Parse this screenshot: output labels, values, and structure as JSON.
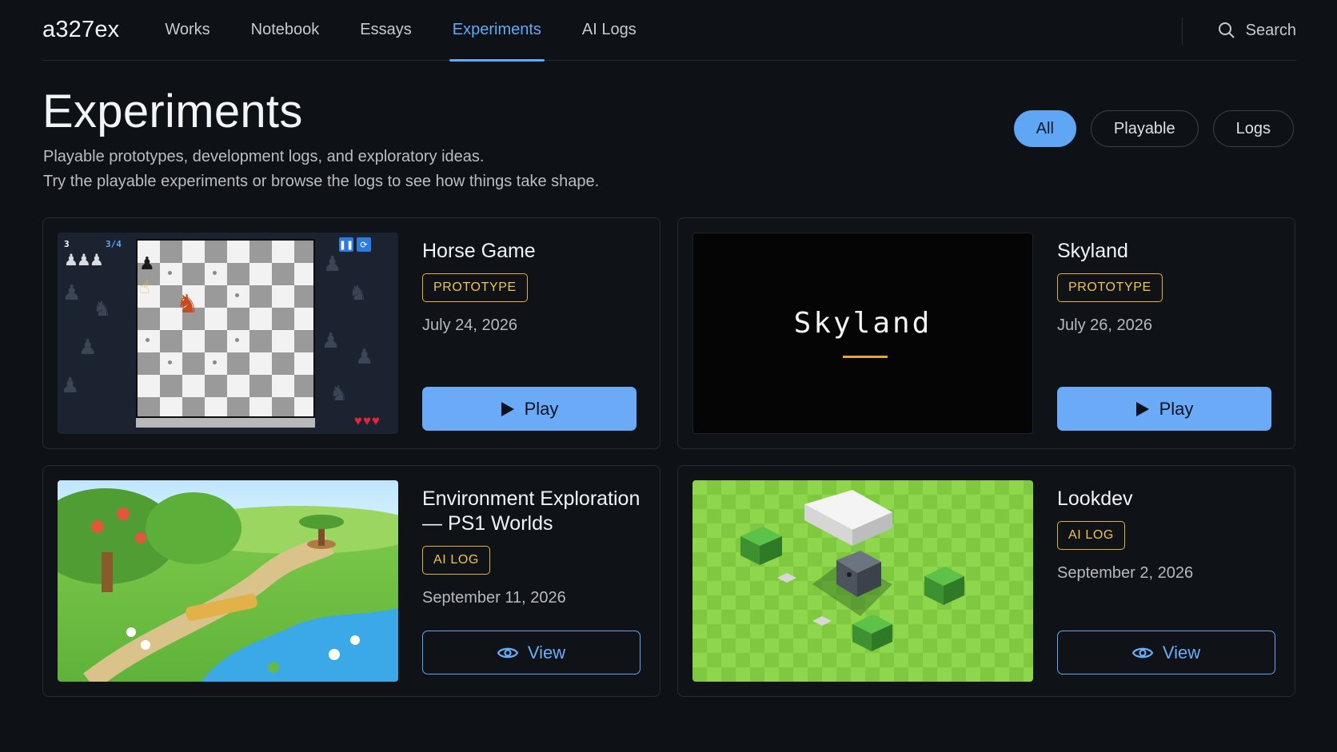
{
  "nav": {
    "brand": "a327ex",
    "links": [
      {
        "label": "Works"
      },
      {
        "label": "Notebook"
      },
      {
        "label": "Essays"
      },
      {
        "label": "Experiments",
        "active": true
      },
      {
        "label": "AI Logs"
      }
    ],
    "search_label": "Search",
    "search_icon": "search-icon"
  },
  "header": {
    "title": "Experiments",
    "subtitle_line1": "Playable prototypes, development logs, and exploratory ideas.",
    "subtitle_line2": "Try the playable experiments or browse the logs to see how things take shape."
  },
  "filters": [
    {
      "label": "All",
      "active": true
    },
    {
      "label": "Playable"
    },
    {
      "label": "Logs"
    }
  ],
  "cards": [
    {
      "title": "Horse Game",
      "badge": "PROTOTYPE",
      "date": "July 24, 2026",
      "action": "Play",
      "action_icon": "play-icon",
      "thumb": {
        "level": "3",
        "progress": "3/4",
        "hearts": "♥♥♥"
      }
    },
    {
      "title": "Skyland",
      "badge": "PROTOTYPE",
      "date": "July 26, 2026",
      "action": "Play",
      "action_icon": "play-icon",
      "thumb": {
        "word": "Skyland"
      }
    },
    {
      "title": "Environment Exploration — PS1 Worlds",
      "badge": "AI LOG",
      "date": "September 11, 2026",
      "action": "View",
      "action_icon": "eye-icon"
    },
    {
      "title": "Lookdev",
      "badge": "AI LOG",
      "date": "September 2, 2026",
      "action": "View",
      "action_icon": "eye-icon"
    }
  ],
  "colors": {
    "background": "#0e1116",
    "accent": "#5fa6f5",
    "badge": "#e4b233",
    "border": "#272b32"
  }
}
